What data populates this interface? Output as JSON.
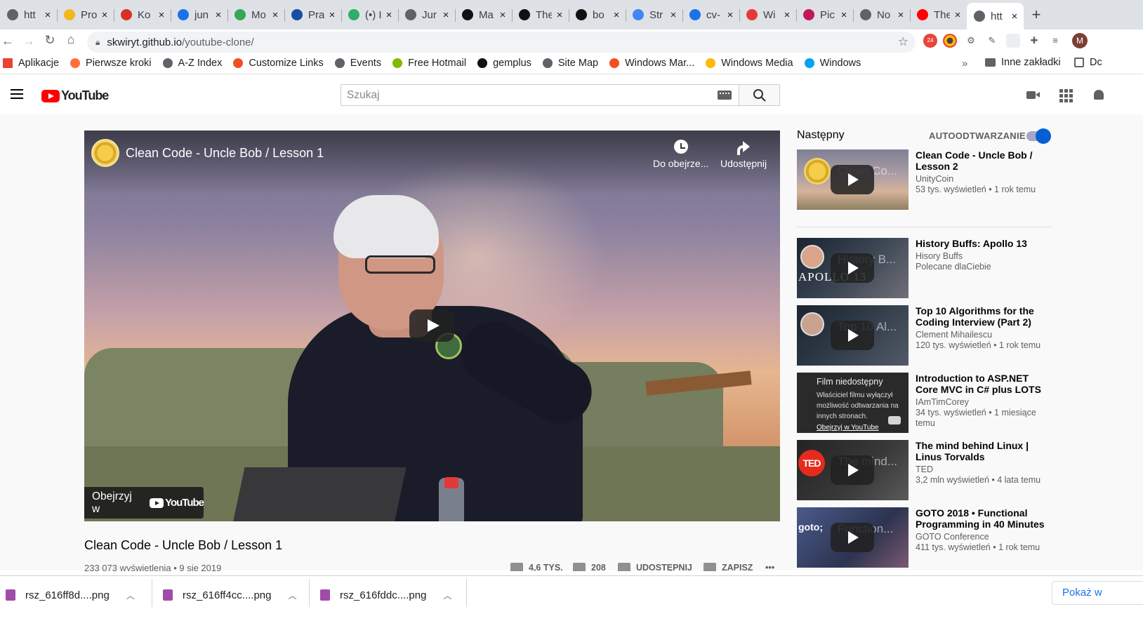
{
  "browser": {
    "tabs": [
      {
        "title": "htt",
        "color": "#5f6368"
      },
      {
        "title": "Pro",
        "color": "#f2b81c"
      },
      {
        "title": "Ko",
        "color": "#d93025"
      },
      {
        "title": "jun",
        "color": "#1a73e8"
      },
      {
        "title": "Mo",
        "color": "#34a853"
      },
      {
        "title": "Pra",
        "color": "#174ea6"
      },
      {
        "title": "(•) I",
        "color": "#2eae6b"
      },
      {
        "title": "Jur",
        "color": "#5f6368"
      },
      {
        "title": "Ma",
        "color": "#111111"
      },
      {
        "title": "The",
        "color": "#111111"
      },
      {
        "title": "bo",
        "color": "#111111"
      },
      {
        "title": "Str",
        "color": "#4285f4"
      },
      {
        "title": "cv-",
        "color": "#1a73e8"
      },
      {
        "title": "Wi",
        "color": "#e53935"
      },
      {
        "title": "Pic",
        "color": "#c2185b"
      },
      {
        "title": "No",
        "color": "#5f6368"
      },
      {
        "title": "The",
        "color": "#ff0000"
      },
      {
        "title": "htt",
        "color": "#5f6368"
      }
    ],
    "url_domain": "skwiryt.github.io",
    "url_path": "/youtube-clone/",
    "avatar_letter": "M",
    "bookmarks": [
      {
        "label": "Aplikacje",
        "color": "#ea4335"
      },
      {
        "label": "Pierwsze kroki",
        "color": "#ff7139"
      },
      {
        "label": "A-Z Index",
        "color": "#5f6368"
      },
      {
        "label": "Customize Links",
        "color": "#f25022"
      },
      {
        "label": "Events",
        "color": "#5f6368"
      },
      {
        "label": "Free Hotmail",
        "color": "#7fba00"
      },
      {
        "label": "gemplus",
        "color": "#111111"
      },
      {
        "label": "Site Map",
        "color": "#5f6368"
      },
      {
        "label": "Windows Mar...",
        "color": "#f25022"
      },
      {
        "label": "Windows Media",
        "color": "#ffb900"
      },
      {
        "label": "Windows",
        "color": "#00a4ef"
      }
    ],
    "other_bookmarks": "Inne zakładki",
    "last_bookmark": "Dc"
  },
  "youtube": {
    "logo_text": "YouTube",
    "search_placeholder": "Szukaj",
    "player": {
      "title": "Clean Code - Uncle Bob / Lesson 1",
      "watch_later": "Do obejrze...",
      "share": "Udostępnij",
      "watch_on": "Obejrzyj w",
      "watch_on_brand": "YouTube"
    },
    "video": {
      "title": "Clean Code - Uncle Bob / Lesson 1",
      "views_date": "233 073 wyświetlenia • 9 sie 2019",
      "likes": "4,6 TYS.",
      "dislikes": "208",
      "share": "UDOSTĘPNIJ",
      "save": "ZAPISZ",
      "more": "•••"
    },
    "sidebar": {
      "next_label": "Następny",
      "autoplay_label": "AUTOODTWARZANIE",
      "autoplay_on": true,
      "items": [
        {
          "title": "Clean Code - Uncle Bob / Lesson 2",
          "thumb_text": "Clean Co...",
          "channel": "UnityCoin",
          "meta": "53 tys. wyświetleń • 1 rok temu"
        },
        {
          "title": "History Buffs: Apollo 13",
          "thumb_text": "History B...",
          "thumb_logo": "APOLLO 13",
          "channel": "Hisory Buffs",
          "meta": "Polecane dlaCiebie"
        },
        {
          "title": "Top 10 Algorithms for the Coding Interview (Part 2)",
          "thumb_text": "Top 10 Al...",
          "channel": "Clement Mihailescu",
          "meta": "120 tys. wyświetleń • 1 rok temu"
        },
        {
          "title": "Introduction to ASP.NET Core MVC in C# plus LOTS of Tips",
          "channel": "IAmTimCorey",
          "meta": "34 tys. wyświetleń • 1 miesiące temu",
          "unavailable_title": "Film niedostępny",
          "unavailable_text": "Właściciel filmu wyłączył możliwość odtwarzania na innych stronach.",
          "unavailable_link": "Obejrzyj w YouTube"
        },
        {
          "title": "The mind behind Linux | Linus Torvalds",
          "thumb_text": "The mind...",
          "thumb_logo": "TED",
          "channel": "TED",
          "meta": "3,2 mln wyświetleń • 4 lata temu"
        },
        {
          "title": "GOTO 2018 • Functional Programming in 40 Minutes",
          "thumb_text": "Function...",
          "thumb_logo": "goto;",
          "channel": "GOTO Conference",
          "meta": "411 tys. wyświetleń • 1 rok temu"
        }
      ]
    }
  },
  "downloads": {
    "files": [
      "rsz_616ff8d....png",
      "rsz_616ff4cc....png",
      "rsz_616fddc....png"
    ],
    "show_all": "Pokaż w"
  }
}
